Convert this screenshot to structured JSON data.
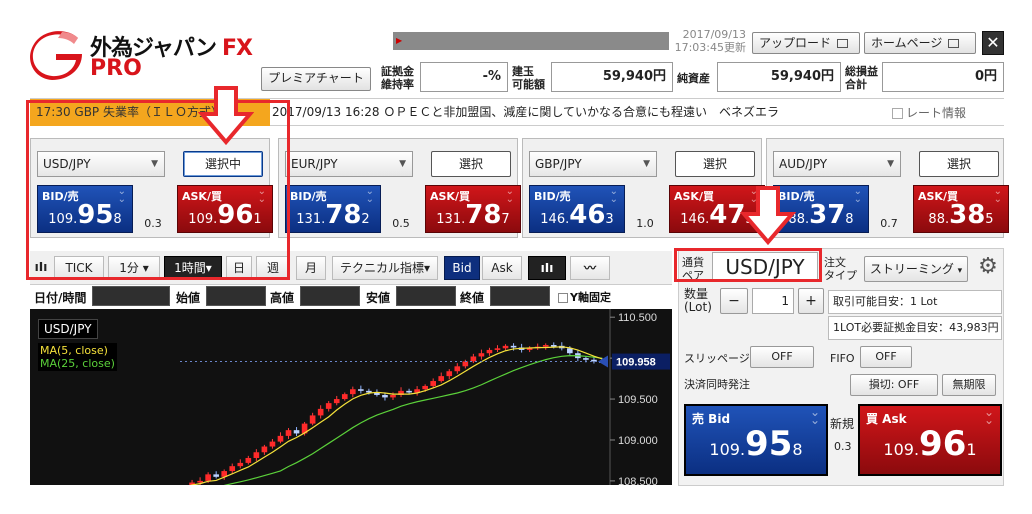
{
  "header": {
    "logo_text": "外為ジャパン",
    "logo_fx": "FX",
    "logo_pro": "PRO",
    "date": "2017/09/13",
    "time": "17:03:45更新",
    "upload_label": "アップロード",
    "home_label": "ホームページ",
    "close_label": "✕",
    "premium_chart_label": "プレミアチャート"
  },
  "stats": {
    "margin_ratio_label_1": "証拠金",
    "margin_ratio_label_2": "維持率",
    "margin_ratio_value": "-%",
    "position_label_1": "建玉",
    "position_label_2": "可能額",
    "position_value": "59,940円",
    "net_assets_label": "純資産",
    "net_assets_value": "59,940円",
    "total_pl_label_1": "総損益",
    "total_pl_label_2": "合計",
    "total_pl_value": "0円"
  },
  "news": {
    "highlight": "17:30 GBP 失業率（ＩＬＯ方式）",
    "headline": "2017/09/13 16:28 ＯＰＥＣと非加盟国、減産に関していかなる合意にも程遠い　ベネズエラ",
    "rate_info_label": "レート情報"
  },
  "panels": [
    {
      "pair": "USD/JPY",
      "button": "選択中",
      "bid_label": "BID/売",
      "ask_label": "ASK/買",
      "bid": {
        "a": "109.",
        "b": "95",
        "c": "8"
      },
      "ask": {
        "a": "109.",
        "b": "96",
        "c": "1"
      },
      "spread": "0.3"
    },
    {
      "pair": "EUR/JPY",
      "button": "選択",
      "bid_label": "BID/売",
      "ask_label": "ASK/買",
      "bid": {
        "a": "131.",
        "b": "78",
        "c": "2"
      },
      "ask": {
        "a": "131.",
        "b": "78",
        "c": "7"
      },
      "spread": "0.5"
    },
    {
      "pair": "GBP/JPY",
      "button": "選択",
      "bid_label": "BID/売",
      "ask_label": "ASK/買",
      "bid": {
        "a": "146.",
        "b": "46",
        "c": "3"
      },
      "ask": {
        "a": "146.",
        "b": "47",
        "c": "3"
      },
      "spread": "1.0"
    },
    {
      "pair": "AUD/JPY",
      "button": "選択",
      "bid_label": "BID/売",
      "ask_label": "ASK/買",
      "bid": {
        "a": "88.",
        "b": "37",
        "c": "8"
      },
      "ask": {
        "a": "88.",
        "b": "38",
        "c": "5"
      },
      "spread": "0.7"
    }
  ],
  "chart_toolbar": {
    "bar_icon": "ıIı",
    "tick": "TICK",
    "min1": "1分 ▾",
    "hour1": "1時間▾",
    "day": "日",
    "week": "週",
    "month": "月",
    "technical": "テクニカル指標▾",
    "bid": "Bid",
    "ask": "Ask",
    "candle_icon": "ıIı",
    "line_icon": "〰"
  },
  "ohlc": {
    "datetime": "日付/時間",
    "open": "始値",
    "high": "高値",
    "low": "安値",
    "close": "終値",
    "y_fixed": "Y軸固定"
  },
  "chart_data": {
    "type": "candlestick",
    "symbol": "USD/JPY",
    "legend": [
      {
        "name": "MA(5, close)",
        "color": "#f5e13a"
      },
      {
        "name": "MA(25, close)",
        "color": "#5bd13a"
      }
    ],
    "y_ticks": [
      "110.500",
      "110.000",
      "109.500",
      "109.000",
      "108.500"
    ],
    "ylim": [
      108.45,
      110.6
    ],
    "current_price": "109.958",
    "closes": [
      108.42,
      108.48,
      108.5,
      108.58,
      108.55,
      108.62,
      108.68,
      108.72,
      108.78,
      108.85,
      108.92,
      108.98,
      109.05,
      109.12,
      109.08,
      109.2,
      109.3,
      109.38,
      109.45,
      109.5,
      109.56,
      109.62,
      109.6,
      109.58,
      109.55,
      109.52,
      109.55,
      109.6,
      109.58,
      109.62,
      109.66,
      109.72,
      109.78,
      109.84,
      109.9,
      109.96,
      110.02,
      110.06,
      110.1,
      110.12,
      110.15,
      110.13,
      110.1,
      110.12,
      110.14,
      110.16,
      110.15,
      110.12,
      110.06,
      110.0,
      109.98,
      109.96,
      109.958
    ]
  },
  "order": {
    "pair_label_1": "通貨",
    "pair_label_2": "ペア",
    "pair": "USD/JPY",
    "type_label_1": "注文",
    "type_label_2": "タイプ",
    "type_value": "ストリーミング",
    "qty_label_1": "数量",
    "qty_label_2": "(Lot)",
    "minus": "−",
    "qty": "1",
    "plus": "+",
    "tradable": "取引可能目安：1 Lot",
    "margin_req": "1LOT必要証拠金目安：43,983円",
    "slippage_label": "スリッページ",
    "slippage_value": "OFF",
    "fifo_label": "FIFO",
    "fifo_value": "OFF",
    "close_simultaneous_label": "決済同時発注",
    "sl_button": "損切: OFF",
    "expiry_button": "無期限",
    "sell_label": "売 Bid",
    "buy_label": "買 Ask",
    "new_label": "新規",
    "spread": "0.3",
    "sell_price": {
      "a": "109.",
      "b": "95",
      "c": "8"
    },
    "buy_price": {
      "a": "109.",
      "b": "96",
      "c": "1"
    }
  },
  "colors": {
    "annotation_red": "#e8282c",
    "bid_blue": "#0b2f82",
    "ask_red": "#8b0a0d",
    "news_orange": "#f4a61e"
  }
}
